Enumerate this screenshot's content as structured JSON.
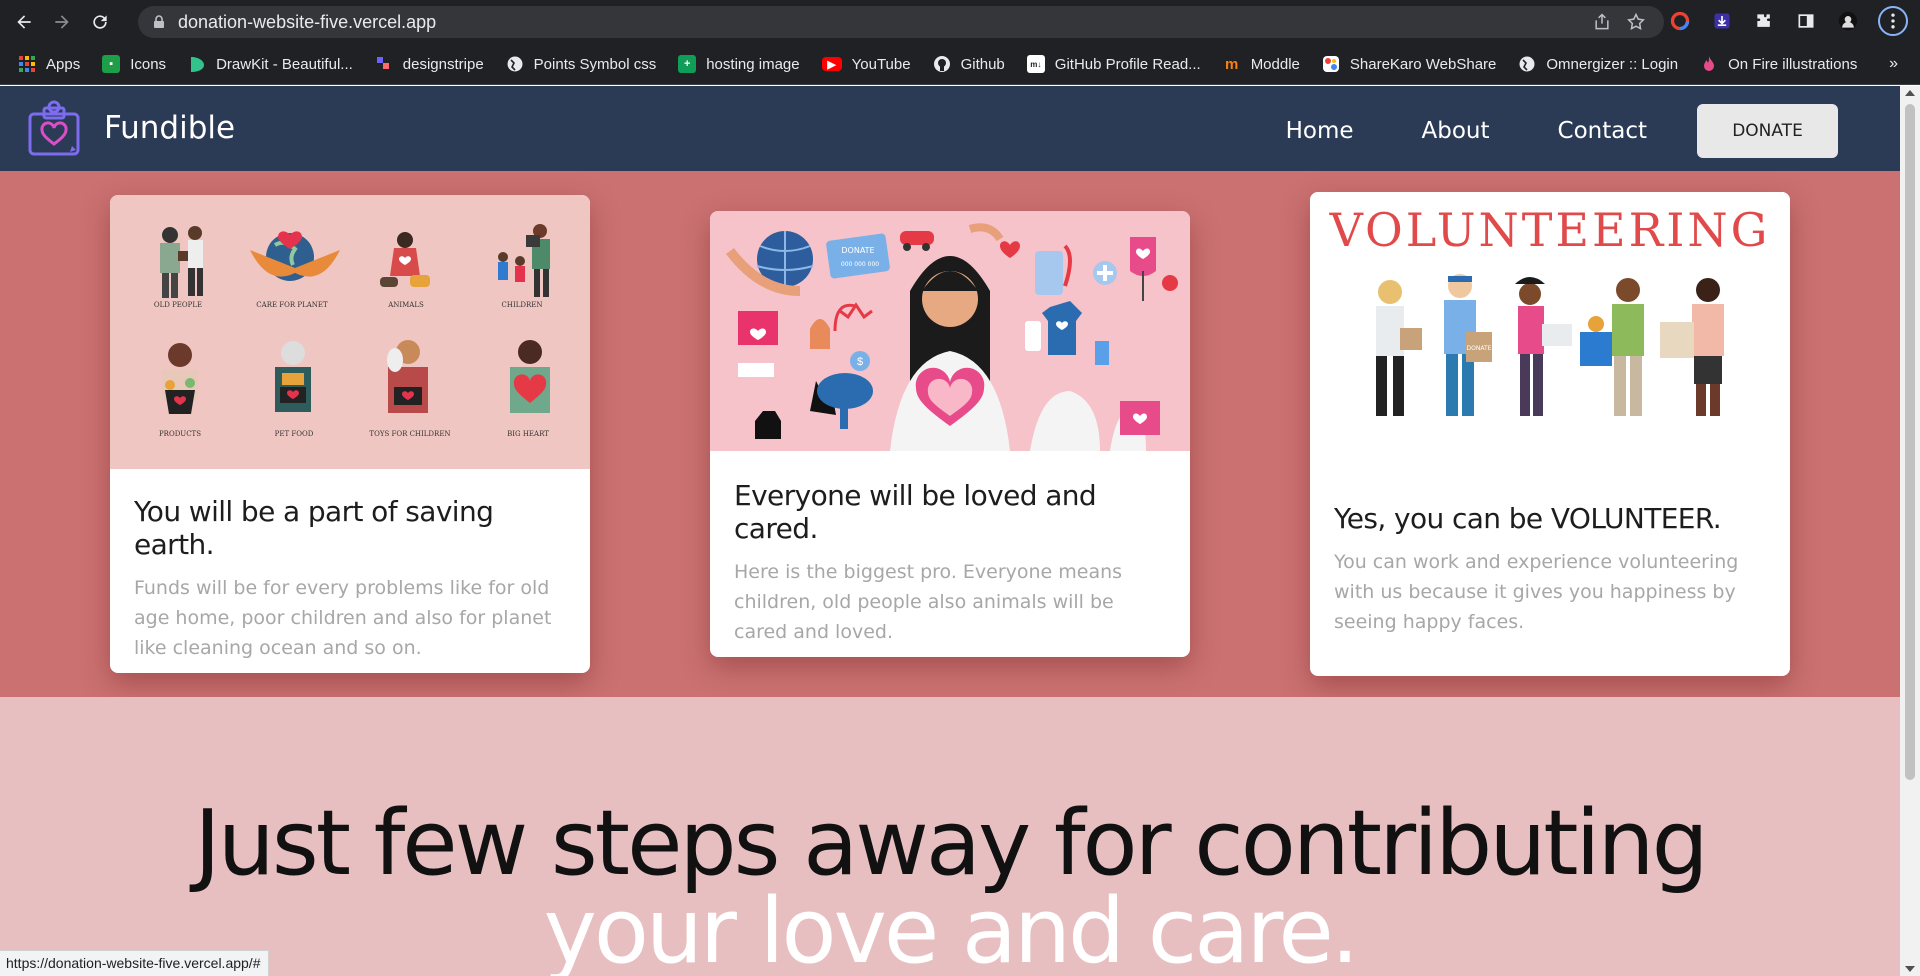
{
  "browser": {
    "url": "donation-website-five.vercel.app",
    "status_url": "https://donation-website-five.vercel.app/#",
    "bookmarks": [
      {
        "label": "Apps",
        "icon": "apps-grid-icon",
        "color": "#ea4335"
      },
      {
        "label": "Icons",
        "icon": "icons-site-icon",
        "color": "#1e9e48"
      },
      {
        "label": "DrawKit - Beautiful...",
        "icon": "drawkit-icon",
        "color": "#32c28c"
      },
      {
        "label": "designstripe",
        "icon": "designstripe-icon",
        "color": "#6c63ff"
      },
      {
        "label": "Points Symbol css",
        "icon": "globe-icon",
        "color": "#9aa0a6"
      },
      {
        "label": "hosting image",
        "icon": "plus-green-icon",
        "color": "#0f9d58"
      },
      {
        "label": "YouTube",
        "icon": "youtube-icon",
        "color": "#ff0000"
      },
      {
        "label": "Github",
        "icon": "github-icon",
        "color": "#ffffff"
      },
      {
        "label": "GitHub Profile Read...",
        "icon": "markdown-icon",
        "color": "#ffffff"
      },
      {
        "label": "Moddle",
        "icon": "moodle-icon",
        "color": "#f98012"
      },
      {
        "label": "ShareKaro WebShare",
        "icon": "sharekaro-icon",
        "color": "#4285f4"
      },
      {
        "label": "Omnergizer :: Login",
        "icon": "globe-icon",
        "color": "#9aa0a6"
      },
      {
        "label": "On Fire illustrations",
        "icon": "fire-icon",
        "color": "#e84b8a"
      }
    ],
    "more_bookmarks": "»"
  },
  "site": {
    "brand": "Fundible",
    "nav": {
      "home": "Home",
      "about": "About",
      "contact": "Contact",
      "donate": "DONATE"
    },
    "colors": {
      "nav_bg": "#2b3a55",
      "cards_bg": "#cb7171",
      "steps_bg": "#e8bfc0"
    }
  },
  "cards": [
    {
      "title": "You will be a part of saving earth.",
      "text": "Funds will be for every problems like for old age home, poor children and also for planet like cleaning ocean and so on.",
      "image_labels": [
        "OLD PEOPLE",
        "CARE FOR PLANET",
        "ANIMALS",
        "CHILDREN",
        "PRODUCTS",
        "PET FOOD",
        "TOYS FOR CHILDREN",
        "BIG HEART"
      ]
    },
    {
      "title": "Everyone will be loved and cared.",
      "text": "Here is the biggest pro. Everyone means children, old people also animals will be cared and loved.",
      "image_labels": [
        "DONATE",
        "000 000 000"
      ]
    },
    {
      "title": "Yes, you can be VOLUNTEER.",
      "text": "You can work and experience volunteering with us because it gives you happiness by seeing happy faces.",
      "image_labels": [
        "VOLUNTEERING",
        "DONATE"
      ]
    }
  ],
  "steps": {
    "line1": "Just few steps away for contributing",
    "line2": "your love and care."
  }
}
